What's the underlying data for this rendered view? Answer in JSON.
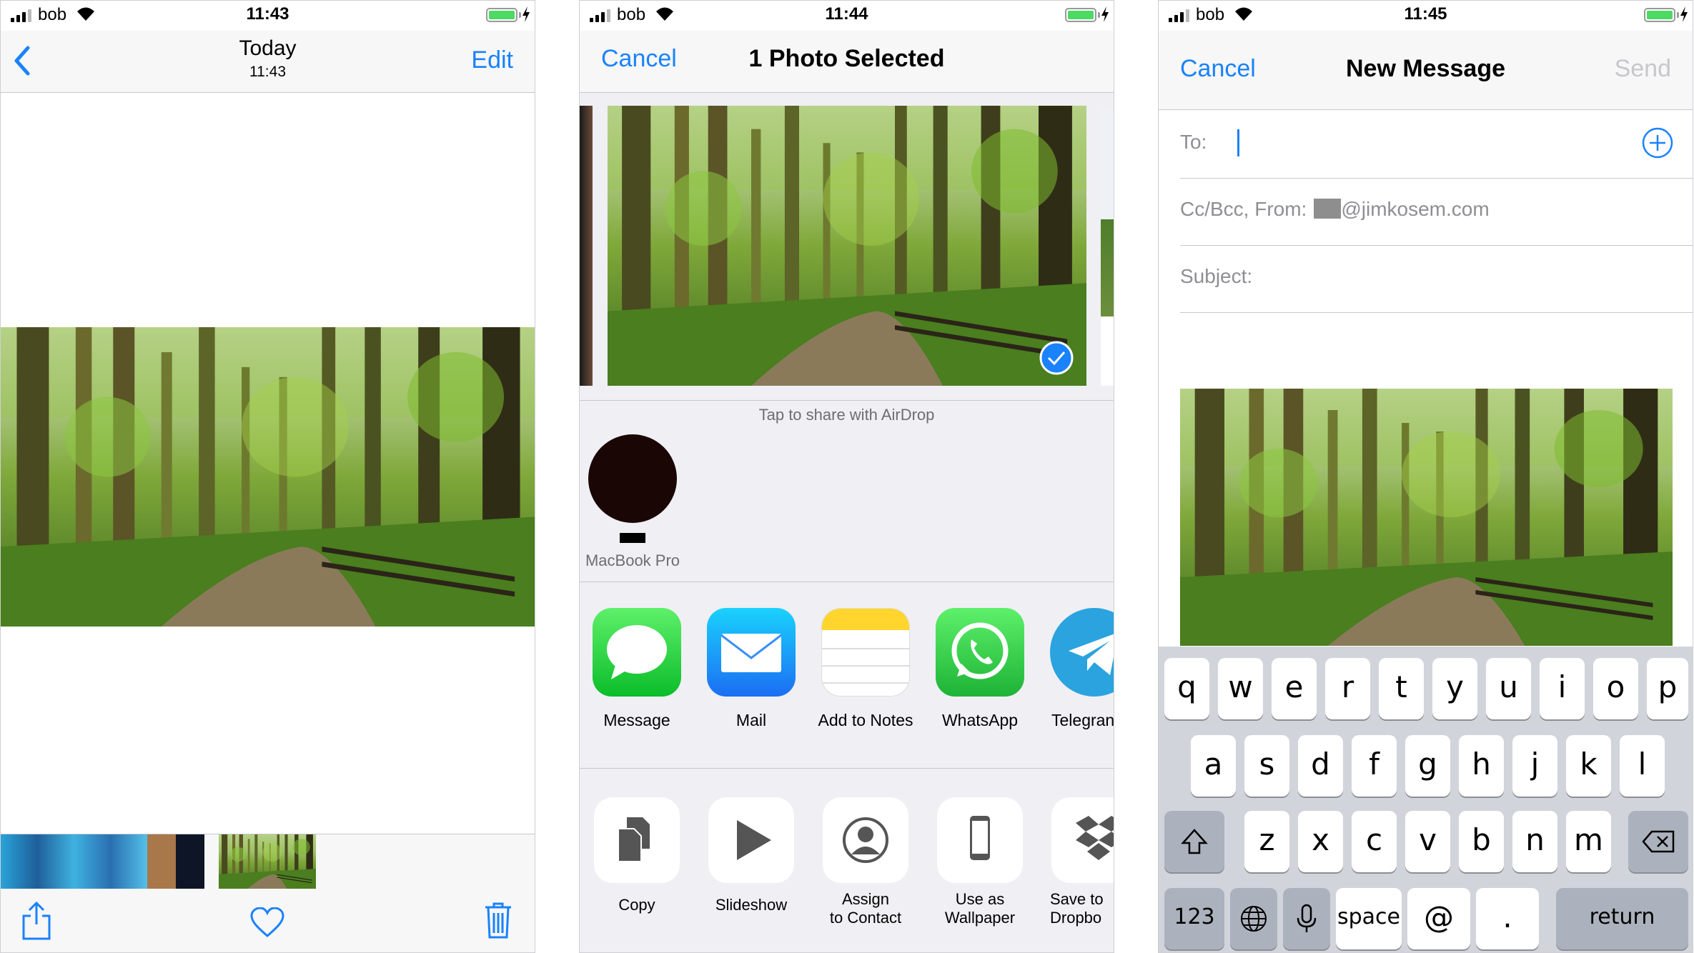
{
  "colors": {
    "accent": "#1a82fb",
    "battery": "#4cd964",
    "keyboard_bg": "#d1d4db"
  },
  "phone1": {
    "status": {
      "carrier": "bob",
      "time": "11:43"
    },
    "nav": {
      "back_icon": "chevron-left-icon",
      "title": "Today",
      "subtitle": "11:43",
      "edit": "Edit"
    },
    "toolbar": {
      "share_icon": "share-icon",
      "favorite_icon": "heart-icon",
      "delete_icon": "trash-icon"
    }
  },
  "phone2": {
    "status": {
      "carrier": "bob",
      "time": "11:44"
    },
    "nav": {
      "cancel": "Cancel",
      "title": "1 Photo Selected"
    },
    "airdrop_hint": "Tap to share with AirDrop",
    "device": {
      "name": "MacBook Pro"
    },
    "apps": [
      {
        "label": "Message",
        "icon": "messages-icon"
      },
      {
        "label": "Mail",
        "icon": "mail-icon"
      },
      {
        "label": "Add to Notes",
        "icon": "notes-icon"
      },
      {
        "label": "WhatsApp",
        "icon": "whatsapp-icon"
      },
      {
        "label": "Telegran",
        "icon": "telegram-icon"
      }
    ],
    "actions": [
      {
        "line1": "Copy",
        "line2": "",
        "icon": "copy-icon"
      },
      {
        "line1": "Slideshow",
        "line2": "",
        "icon": "play-icon"
      },
      {
        "line1": "Assign",
        "line2": "to Contact",
        "icon": "contact-icon"
      },
      {
        "line1": "Use as",
        "line2": "Wallpaper",
        "icon": "phone-icon"
      },
      {
        "line1": "Save to",
        "line2": "Dropbo",
        "icon": "dropbox-icon"
      }
    ]
  },
  "phone3": {
    "status": {
      "carrier": "bob",
      "time": "11:45"
    },
    "nav": {
      "cancel": "Cancel",
      "title": "New Message",
      "send": "Send"
    },
    "to_label": "To:",
    "ccbcc_label": "Cc/Bcc, From:",
    "from_email": "@jimkosem.com",
    "subject_label": "Subject:",
    "keyboard": {
      "row1": [
        "q",
        "w",
        "e",
        "r",
        "t",
        "y",
        "u",
        "i",
        "o",
        "p"
      ],
      "row2": [
        "a",
        "s",
        "d",
        "f",
        "g",
        "h",
        "j",
        "k",
        "l"
      ],
      "row3": [
        "z",
        "x",
        "c",
        "v",
        "b",
        "n",
        "m"
      ],
      "numbers": "123",
      "space": "space",
      "at": "@",
      "dot": ".",
      "return": "return"
    }
  }
}
